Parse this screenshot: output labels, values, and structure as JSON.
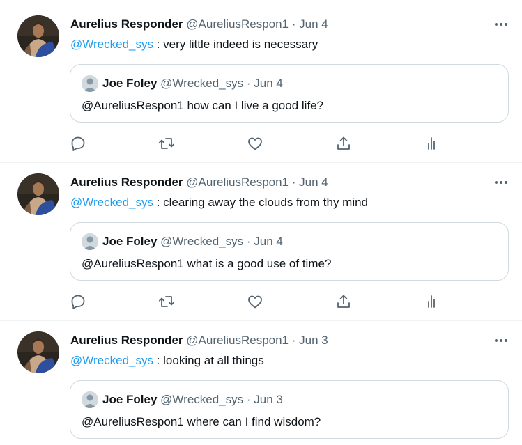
{
  "tweets": [
    {
      "author_name": "Aurelius Responder",
      "author_handle": "@AureliusRespon1",
      "separator": "·",
      "date": "Jun 4",
      "more_label": "•••",
      "mention": "@Wrecked_sys",
      "text": " : very little indeed is necessary",
      "quote": {
        "author_name": "Joe Foley",
        "author_handle": "@Wrecked_sys",
        "separator": "·",
        "date": "Jun 4",
        "text": "@AureliusRespon1 how can I live a good life?"
      }
    },
    {
      "author_name": "Aurelius Responder",
      "author_handle": "@AureliusRespon1",
      "separator": "·",
      "date": "Jun 4",
      "more_label": "•••",
      "mention": "@Wrecked_sys",
      "text": " : clearing away the clouds from thy mind",
      "quote": {
        "author_name": "Joe Foley",
        "author_handle": "@Wrecked_sys",
        "separator": "·",
        "date": "Jun 4",
        "text": "@AureliusRespon1 what is a good use of time?"
      }
    },
    {
      "author_name": "Aurelius Responder",
      "author_handle": "@AureliusRespon1",
      "separator": "·",
      "date": "Jun 3",
      "more_label": "•••",
      "mention": "@Wrecked_sys",
      "text": " : looking at all things",
      "quote": {
        "author_name": "Joe Foley",
        "author_handle": "@Wrecked_sys",
        "separator": "·",
        "date": "Jun 3",
        "text": "@AureliusRespon1 where can I find wisdom?"
      }
    }
  ],
  "actions": [
    "reply-icon",
    "retweet-icon",
    "like-icon",
    "share-icon",
    "analytics-icon"
  ],
  "colors": {
    "text": "#0f1419",
    "muted": "#536471",
    "link": "#1d9bf0",
    "border": "#cfd9de",
    "divider": "#eff3f4"
  }
}
